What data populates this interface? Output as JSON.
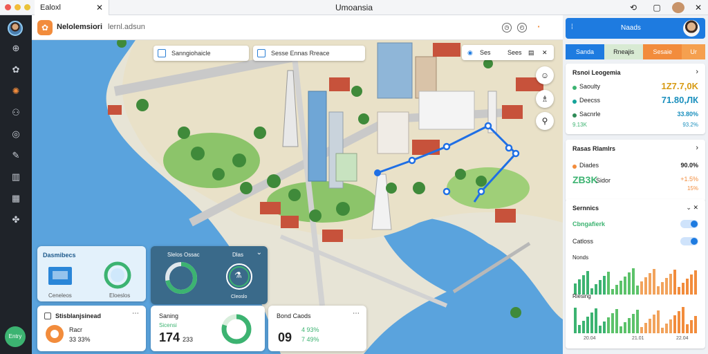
{
  "window": {
    "tab_title": "Ealoxl",
    "title": "Umoansia",
    "tab_close": "✕",
    "controls": [
      "⟲",
      "▢",
      "✕"
    ]
  },
  "rail": {
    "icons": [
      "globe-icon",
      "gear-icon",
      "flower-icon",
      "nodes-icon",
      "compass-icon",
      "tools-icon",
      "chart-icon",
      "layers-icon",
      "palette-icon"
    ],
    "glyphs": [
      "⊕",
      "✿",
      "✺",
      "⚇",
      "◎",
      "✎",
      "▥",
      "▦",
      "✤"
    ],
    "fab_label": "Entry"
  },
  "map_header": {
    "title": "Nelolemsiori",
    "subtitle": "lernl.adsun",
    "icons": [
      "◷",
      "◴",
      "▪"
    ]
  },
  "map": {
    "search_left": "Sanngiohaicle",
    "search_right": "Sesse Ennas Rreace",
    "toolbar": [
      "◉",
      "Ses",
      "Sees",
      "▤",
      "✕"
    ],
    "fab_glyphs": [
      "☺",
      "♗",
      "⚲"
    ]
  },
  "widgets": {
    "w1": {
      "title": "Dasmibecs",
      "label_left": "Ceneleos",
      "label_right": "Eloeslos"
    },
    "w2": {
      "label_left": "Slelos Ossac",
      "label_right": "Dlas",
      "label_bottom": "Cleoslo",
      "progress_pct": 72,
      "center_glyph": "⚗",
      "chevron": "⌄"
    },
    "w3": {
      "title": "Stisblanjsinead",
      "line1": "Racr",
      "line2": "33 33%",
      "menu": "⋯"
    },
    "w4": {
      "title": "Saning",
      "sub": "Sicensi",
      "big": "174",
      "small": "233",
      "progress_pct": 80
    },
    "w5": {
      "title": "Bond Caods",
      "big": "09",
      "small1": "4 93%",
      "small2": "7 49%",
      "menu": "⋯"
    }
  },
  "panel": {
    "header": "Naads",
    "tabs": [
      "Sanda",
      "Rneajis",
      "Sesaie",
      "Ur"
    ],
    "summary": {
      "title": "Rsnoi Leogemia",
      "chevron": "›",
      "rows": [
        {
          "label": "Saoulty",
          "value": "1Z7.7,0K",
          "color": "#3cb371",
          "value_color": "#d79a12"
        },
        {
          "label": "Deecss",
          "value": "71.80,ЛК",
          "color": "#15a39a",
          "value_color": "#1a8fbd"
        },
        {
          "label": "Sacnrle",
          "value": "33.80%",
          "color": "#2e8b57",
          "value_color": "#1a8fbd"
        }
      ],
      "foot_left": "9.13K",
      "foot_right": "93.2%"
    },
    "metrics": {
      "title": "Rasas Rlamlrs",
      "chevron": "›",
      "row_label": "Diades",
      "row_value": "90.0%",
      "big": "ZB3K",
      "big_sub": "Sidor",
      "delta": "+1.5%",
      "delta2": "15%"
    },
    "settings": {
      "title": "Sernnics",
      "controls": "⌄  ✕",
      "toggles": [
        "Cbngafierk",
        "Catloss"
      ],
      "chart1_label": "Nonds",
      "chart2_label": "Riesing",
      "axis": [
        "20.04",
        "21.01",
        "22.04"
      ]
    }
  },
  "colors": {
    "water": "#5aa3dd",
    "land": "#e9e1c8",
    "grass": "#8cc46a",
    "road": "#c9c9c9",
    "route": "#1f6fe5",
    "accent": "#1e7be0",
    "orange": "#f28c3c",
    "green": "#3cb371"
  }
}
